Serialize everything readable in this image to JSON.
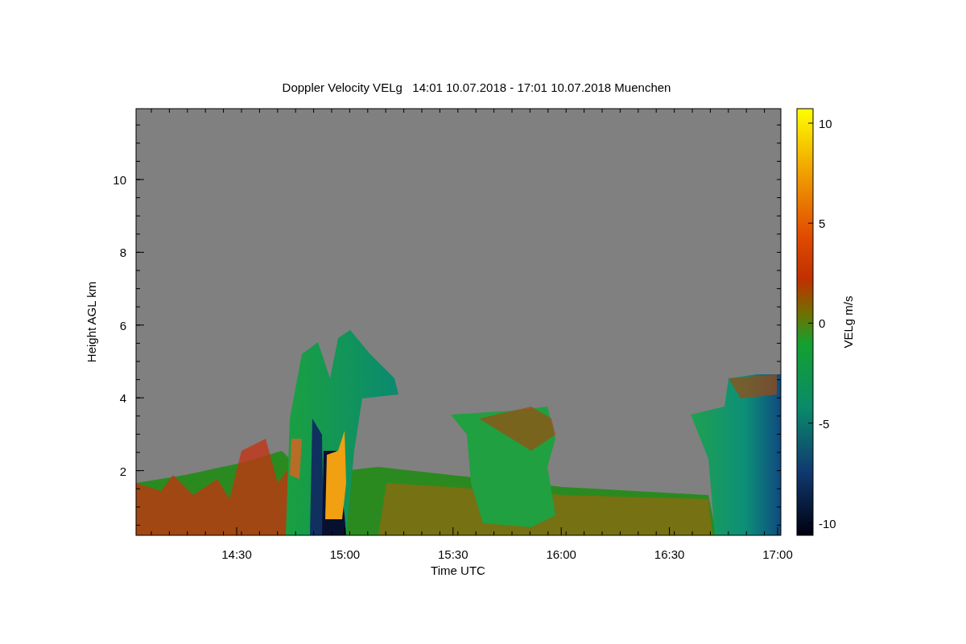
{
  "figure": {
    "title": "Doppler Velocity VELg   14:01 10.07.2018 - 17:01 10.07.2018 Muenchen",
    "y_axis": {
      "label": "Height AGL km",
      "ticks": [
        "10",
        "8",
        "6",
        "4",
        "2"
      ]
    },
    "x_axis": {
      "label": "Time UTC",
      "ticks": [
        "14:30",
        "15:00",
        "15:30",
        "16:00",
        "16:30",
        "17:00"
      ]
    },
    "colorbar": {
      "label": "VELg m/s",
      "ticks": [
        "10",
        "5",
        "0",
        "-5",
        "-10"
      ]
    }
  }
}
